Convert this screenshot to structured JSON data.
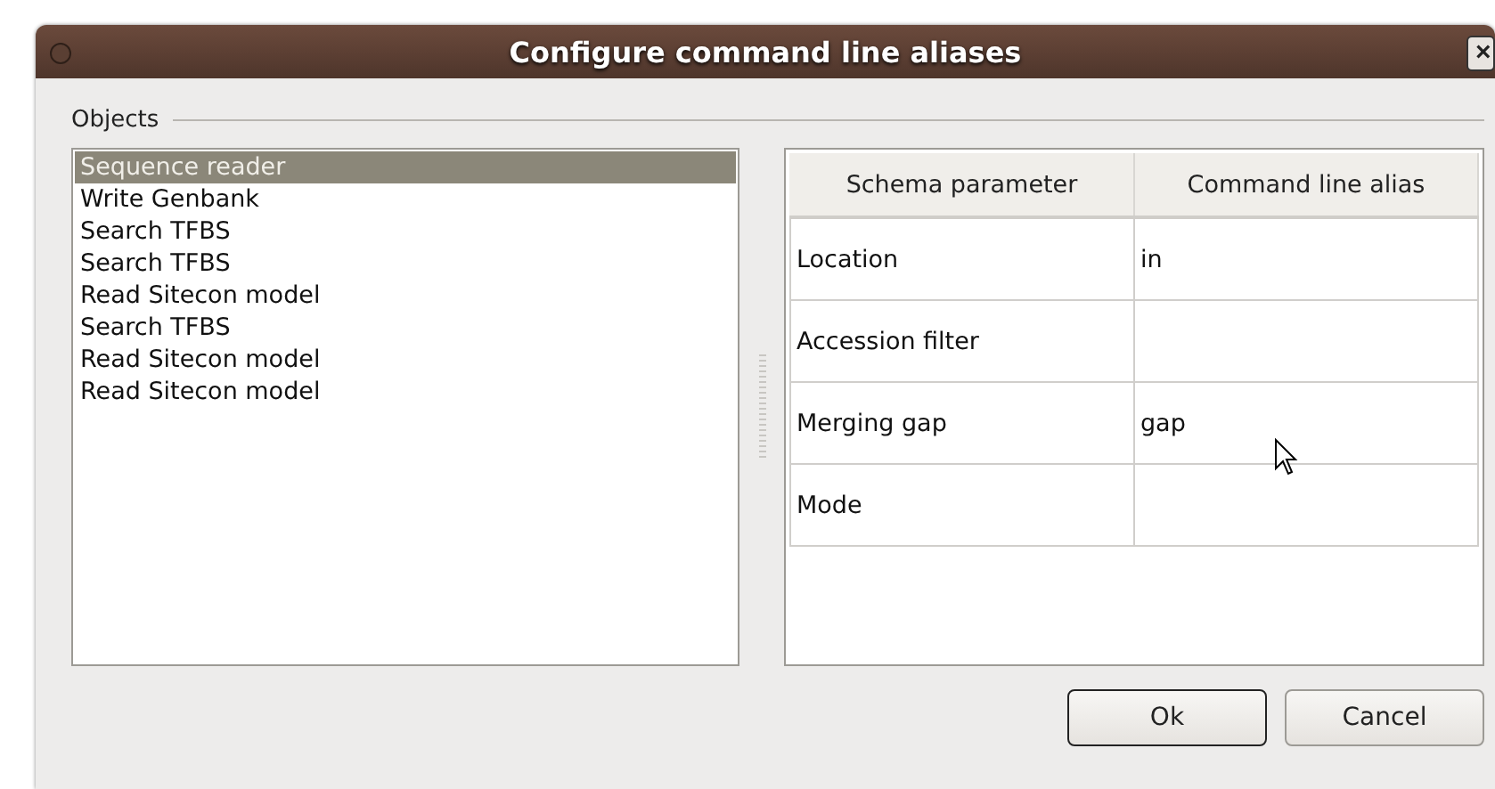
{
  "window": {
    "title": "Configure command line aliases",
    "close": "×"
  },
  "group": {
    "label": "Objects"
  },
  "objects": [
    {
      "label": "Sequence reader",
      "selected": true
    },
    {
      "label": "Write Genbank",
      "selected": false
    },
    {
      "label": "Search TFBS",
      "selected": false
    },
    {
      "label": "Search TFBS",
      "selected": false
    },
    {
      "label": "Read Sitecon model",
      "selected": false
    },
    {
      "label": "Search TFBS",
      "selected": false
    },
    {
      "label": "Read Sitecon model",
      "selected": false
    },
    {
      "label": "Read Sitecon model",
      "selected": false
    }
  ],
  "table": {
    "columns": [
      "Schema parameter",
      "Command line alias"
    ],
    "rows": [
      [
        "Location",
        "in"
      ],
      [
        "Accession filter",
        ""
      ],
      [
        "Merging gap",
        "gap"
      ],
      [
        "Mode",
        ""
      ]
    ]
  },
  "buttons": [
    {
      "label": "Ok",
      "default": true
    },
    {
      "label": "Cancel",
      "default": false
    }
  ]
}
